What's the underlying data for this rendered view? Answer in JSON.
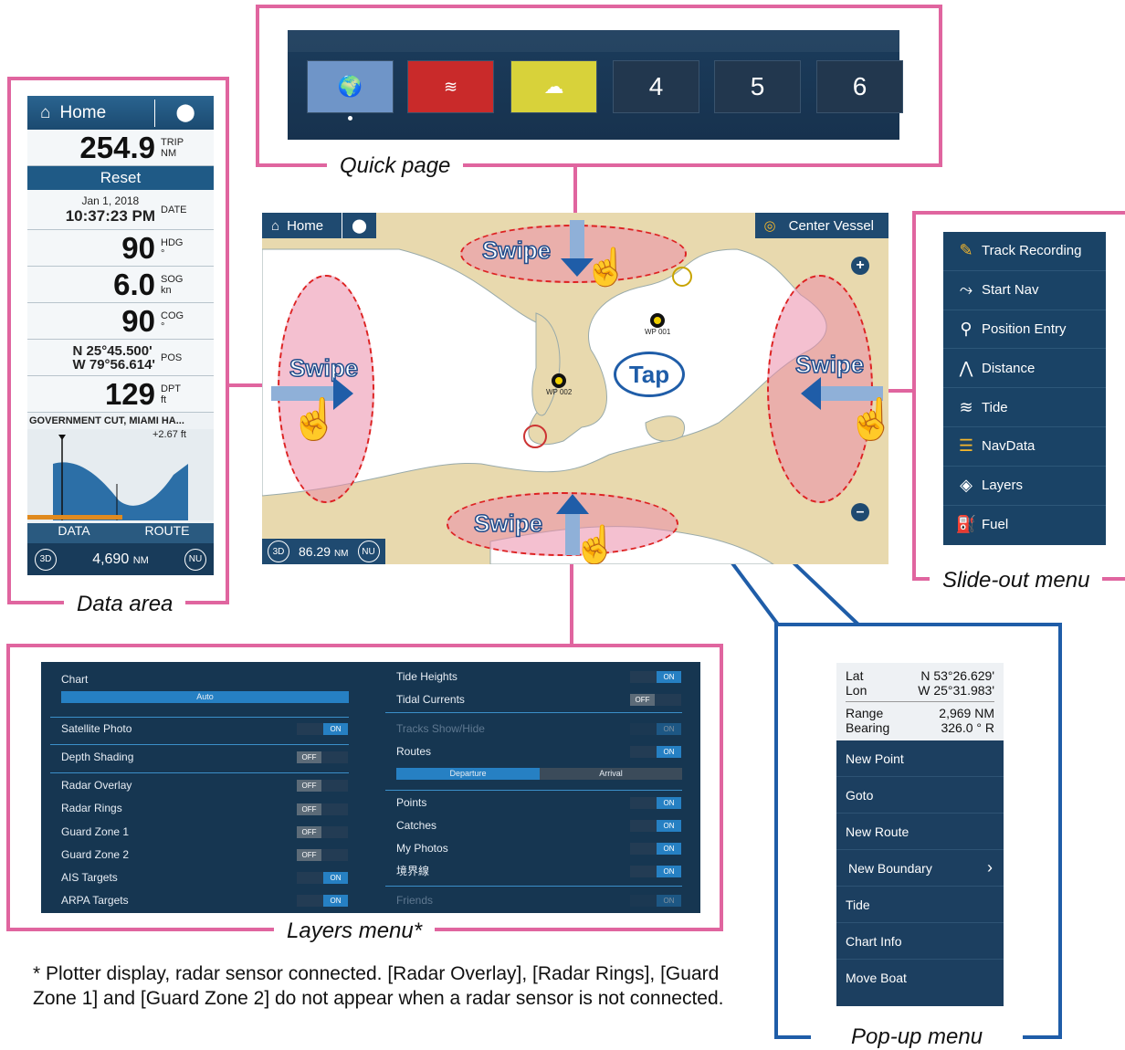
{
  "captions": {
    "quick_page": "Quick page",
    "data_area": "Data area",
    "slide_out": "Slide-out menu",
    "layers": "Layers menu*",
    "popup": "Pop-up menu"
  },
  "quick_page": {
    "buttons": [
      "4",
      "5",
      "6"
    ]
  },
  "data_area": {
    "home": "Home",
    "trip": "254.9",
    "trip_label": "TRIP",
    "trip_unit": "NM",
    "reset": "Reset",
    "date": "Jan 1, 2018",
    "time": "10:37:23 PM",
    "date_label": "DATE",
    "hdg": "90",
    "hdg_label": "HDG",
    "hdg_unit": "°",
    "sog": "6.0",
    "sog_label": "SOG",
    "sog_unit": "kn",
    "cog": "90",
    "cog_label": "COG",
    "cog_unit": "°",
    "lat": "N 25°45.500'",
    "lon": "W 79°56.614'",
    "pos_label": "POS",
    "dpt": "129",
    "dpt_label": "DPT",
    "dpt_unit": "ft",
    "tide_station": "GOVERNMENT CUT, MIAMI HA...",
    "tide_value": "+2.67 ft",
    "tab_data": "DATA",
    "tab_route": "ROUTE",
    "range": "4,690",
    "range_unit": "NM",
    "btn_3d": "3D",
    "btn_nu": "NU"
  },
  "map": {
    "home": "Home",
    "center_vessel": "Center Vessel",
    "wp1": "WP 001",
    "wp2": "WP 002",
    "range": "86.29",
    "range_unit": "NM",
    "btn_3d": "3D",
    "btn_nu": "NU",
    "swipe": "Swipe",
    "tap": "Tap",
    "plus": "+",
    "minus": "–"
  },
  "slide_out": {
    "items": [
      "Track Recording",
      "Start Nav",
      "Position Entry",
      "Distance",
      "Tide",
      "NavData",
      "Layers",
      "Fuel"
    ]
  },
  "layers": {
    "chart": "Chart",
    "auto": "Auto",
    "left": [
      "Satellite Photo",
      "Depth Shading",
      "Radar Overlay",
      "Radar Rings",
      "Guard Zone 1",
      "Guard Zone 2",
      "AIS Targets",
      "ARPA Targets"
    ],
    "right": [
      "Tide Heights",
      "Tidal Currents",
      "Tracks Show/Hide",
      "Routes",
      "Points",
      "Catches",
      "My Photos",
      "境界線",
      "Friends"
    ],
    "departure": "Departure",
    "arrival": "Arrival",
    "on": "ON",
    "off": "OFF"
  },
  "popup": {
    "lat_label": "Lat",
    "lat": "N 53°26.629'",
    "lon_label": "Lon",
    "lon": "W 25°31.983'",
    "range_label": "Range",
    "range": "2,969 NM",
    "bearing_label": "Bearing",
    "bearing": "326.0 ° R",
    "items": [
      "New Point",
      "Goto",
      "New Route",
      "New Boundary",
      "Tide",
      "Chart Info",
      "Move Boat"
    ]
  },
  "note": "* Plotter display, radar sensor connected. [Radar Overlay], [Radar Rings], [Guard Zone 1] and [Guard Zone 2] do not appear when a radar sensor is not connected.",
  "colors": {
    "frame": "#e0659f",
    "popup_line": "#1f5da8",
    "panel": "#16324c",
    "accent_on": "#2680c3"
  }
}
